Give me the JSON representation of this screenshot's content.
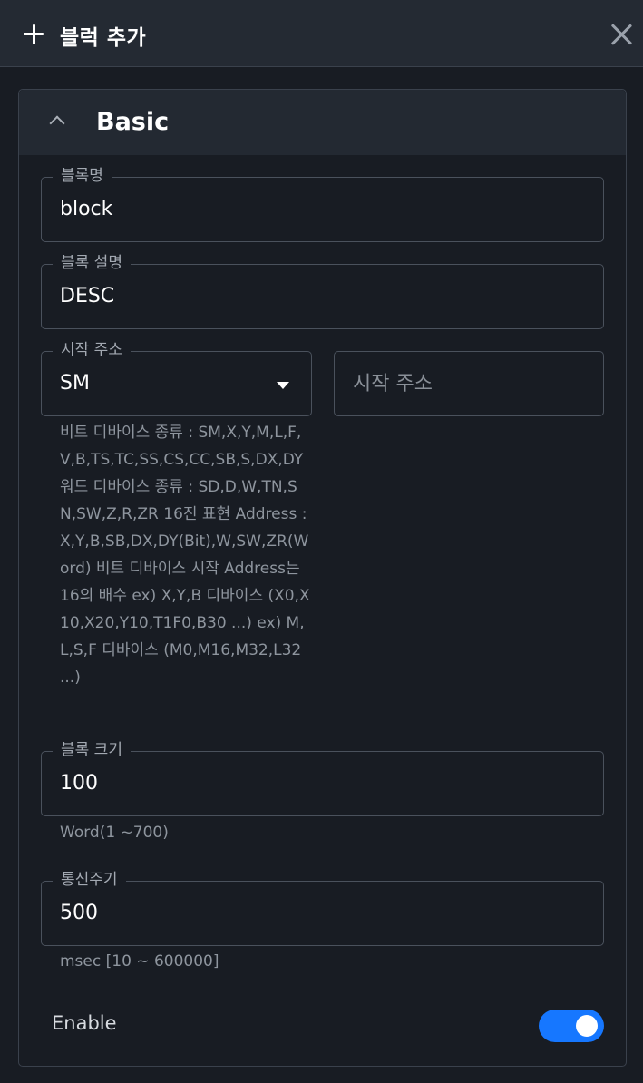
{
  "header": {
    "title": "블럭 추가",
    "plus_icon": "plus-icon",
    "close_icon": "close-icon"
  },
  "section": {
    "title": "Basic",
    "expanded": true,
    "chevron_icon": "chevron-up-icon"
  },
  "fields": {
    "block_name": {
      "label": "블록명",
      "value": "block"
    },
    "block_desc": {
      "label": "블록 설명",
      "value": "DESC"
    },
    "start_address": {
      "label": "시작 주소",
      "selected_device": "SM",
      "address_placeholder": "시작 주소",
      "help": "비트 디바이스 종류 : SM,X,Y,M,L,F,V,B,TS,TC,SS,CS,CC,SB,S,DX,DY 워드 디바이스 종류 : SD,D,W,TN,SN,SW,Z,R,ZR 16진 표현 Address : X,Y,B,SB,DX,DY(Bit),W,SW,ZR(Word) 비트 디바이스 시작 Address는 16의 배수 ex) X,Y,B 디바이스 (X0,X10,X20,Y10,T1F0,B30 ...) ex) M,L,S,F 디바이스 (M0,M16,M32,L32 ...)"
    },
    "block_size": {
      "label": "블록 크기",
      "value": "100",
      "help": "Word(1 ~700)"
    },
    "comm_period": {
      "label": "통신주기",
      "value": "500",
      "help": "msec [10 ~ 600000]"
    }
  },
  "enable": {
    "label": "Enable",
    "on": true
  },
  "colors": {
    "background": "#181c23",
    "header_bg": "#242a33",
    "accent": "#1677ff",
    "border": "#4a515c"
  }
}
